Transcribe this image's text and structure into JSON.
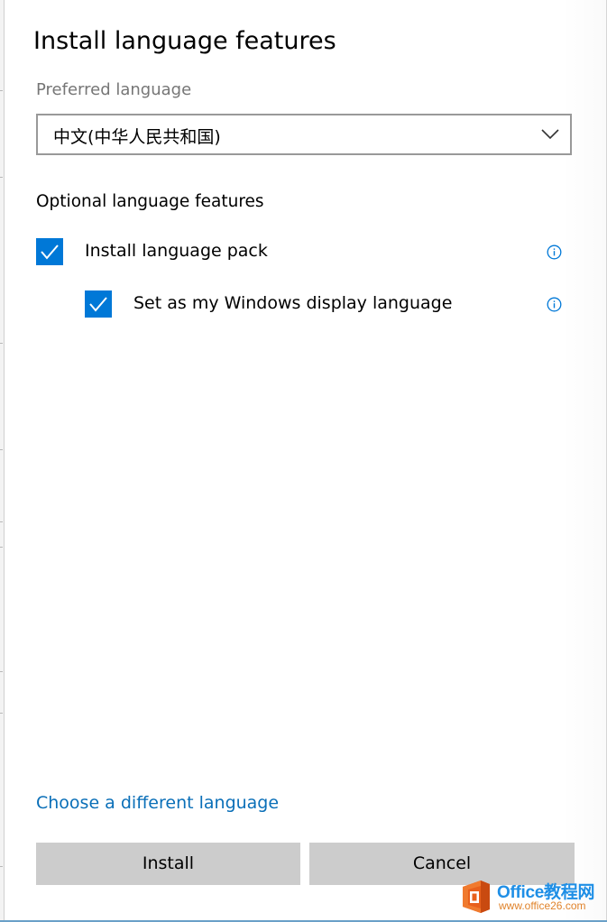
{
  "dialog": {
    "title": "Install language features",
    "preferred_language_label": "Preferred language",
    "preferred_language_value": "中文(中华人民共和国)",
    "optional_heading": "Optional language features",
    "options": [
      {
        "label": "Install language pack",
        "checked": true
      },
      {
        "label": "Set as my Windows display language",
        "checked": true
      }
    ],
    "choose_link": "Choose a different language",
    "install_button": "Install",
    "cancel_button": "Cancel"
  },
  "icons": {
    "dropdown": "chevron-down-icon",
    "checkbox": "checkmark-icon",
    "info": "info-icon"
  },
  "colors": {
    "accent": "#0078d7",
    "link": "#0a6fb8",
    "button_bg": "#cccccc",
    "muted_text": "#767676",
    "select_border": "#999999"
  },
  "watermark": {
    "brand": "Office教程网",
    "url": "www.office26.com"
  }
}
